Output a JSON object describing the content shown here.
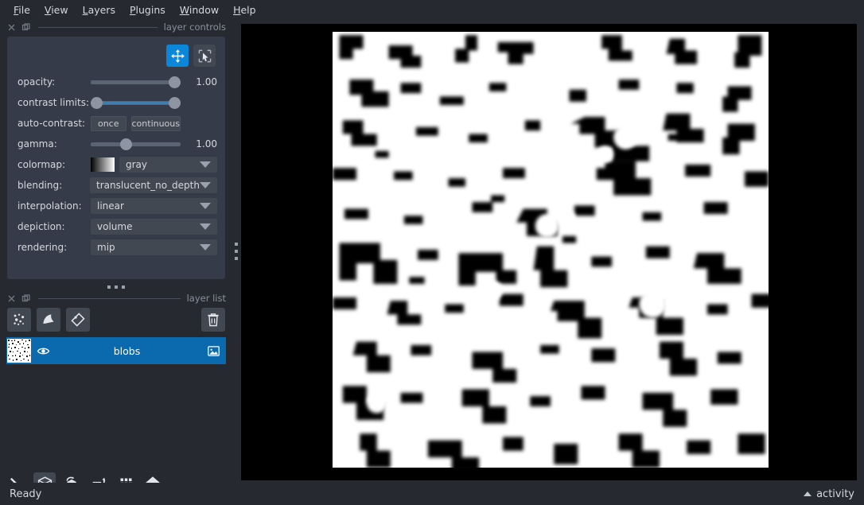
{
  "menubar": {
    "items": [
      {
        "label": "File",
        "mnemonic": "F"
      },
      {
        "label": "View",
        "mnemonic": "V"
      },
      {
        "label": "Layers",
        "mnemonic": "L"
      },
      {
        "label": "Plugins",
        "mnemonic": "P"
      },
      {
        "label": "Window",
        "mnemonic": "W"
      },
      {
        "label": "Help",
        "mnemonic": "H"
      }
    ]
  },
  "docks": {
    "layer_controls_title": "layer controls",
    "layer_list_title": "layer list"
  },
  "layer_controls": {
    "mode_buttons": [
      {
        "name": "pan-zoom",
        "active": true
      },
      {
        "name": "transform",
        "active": false
      }
    ],
    "opacity": {
      "label": "opacity:",
      "value": "1.00",
      "percent": 100
    },
    "contrast_limits": {
      "label": "contrast limits:",
      "low_percent": 0,
      "high_percent": 100
    },
    "auto_contrast": {
      "label": "auto-contrast:",
      "once": "once",
      "continuous": "continuous"
    },
    "gamma": {
      "label": "gamma:",
      "value": "1.00",
      "percent": 33
    },
    "colormap": {
      "label": "colormap:",
      "value": "gray"
    },
    "blending": {
      "label": "blending:",
      "value": "translucent_no_depth"
    },
    "interpolation": {
      "label": "interpolation:",
      "value": "linear"
    },
    "depiction": {
      "label": "depiction:",
      "value": "volume"
    },
    "rendering": {
      "label": "rendering:",
      "value": "mip"
    }
  },
  "layer_buttons": [
    {
      "name": "new-points-layer",
      "icon": "points-icon"
    },
    {
      "name": "new-shapes-layer",
      "icon": "shapes-icon"
    },
    {
      "name": "new-labels-layer",
      "icon": "labels-icon"
    },
    {
      "name": "delete-layer",
      "icon": "trash-icon"
    }
  ],
  "layers": [
    {
      "name": "blobs",
      "visible": true,
      "selected": true,
      "type": "image"
    }
  ],
  "viewer_buttons": [
    {
      "name": "console",
      "icon": "console-icon",
      "raised": false
    },
    {
      "name": "ndisplay-toggle",
      "icon": "cube-wire-icon",
      "raised": true
    },
    {
      "name": "roll-dims",
      "icon": "roll-cube-icon",
      "raised": false
    },
    {
      "name": "transpose-dims",
      "icon": "transpose-icon",
      "raised": false
    },
    {
      "name": "grid-view",
      "icon": "grid-icon",
      "raised": false
    },
    {
      "name": "home",
      "icon": "home-icon",
      "raised": false
    }
  ],
  "statusbar": {
    "status": "Ready",
    "activity": "activity"
  },
  "canvas": {
    "layer_name": "blobs",
    "background": "#000000",
    "image_background": "#ffffff",
    "blob_color": "#000000"
  }
}
